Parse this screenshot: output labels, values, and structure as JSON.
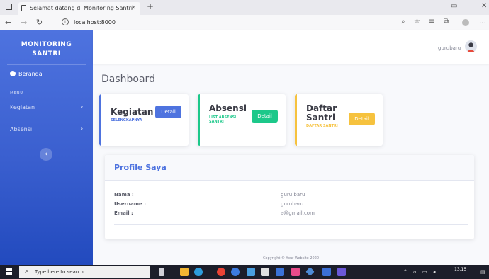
{
  "browser": {
    "tab_title": "Selamat datang di Monitoring Santri",
    "tab_close": "×",
    "new_tab": "+",
    "url": "localhost:8000"
  },
  "sidebar": {
    "brand_line1": "MONITORING",
    "brand_line2": "SANTRI",
    "home_label": "Beranda",
    "menu_heading": "MENU",
    "items": [
      {
        "label": "Kegiatan"
      },
      {
        "label": "Absensi"
      }
    ],
    "toggle_glyph": "‹"
  },
  "topbar": {
    "username": "gurubaru"
  },
  "main": {
    "page_title": "Dashboard",
    "cards": [
      {
        "title": "Kegiatan",
        "subtitle": "SELENGKAPNYA",
        "button": "Detail",
        "accent": "#4e73df"
      },
      {
        "title": "Absensi",
        "subtitle": "LIST ABSENSI SANTRI",
        "button": "Detail",
        "accent": "#1cc88a"
      },
      {
        "title": "Daftar Santri",
        "subtitle": "DAFTAR SANTRI",
        "button": "Detail",
        "accent": "#f6c23e"
      }
    ]
  },
  "profile": {
    "title": "Profile Saya",
    "rows": [
      {
        "label": "Nama :",
        "value": "guru baru"
      },
      {
        "label": "Username :",
        "value": "gurubaru"
      },
      {
        "label": "Email :",
        "value": "a@gmail.com"
      }
    ]
  },
  "footer": {
    "text": "Copyright © Your Website 2020"
  },
  "taskbar": {
    "search_placeholder": "Type here to search",
    "time": "13.15"
  },
  "colors": {
    "primary": "#4e73df",
    "success": "#1cc88a",
    "warning": "#f6c23e"
  }
}
